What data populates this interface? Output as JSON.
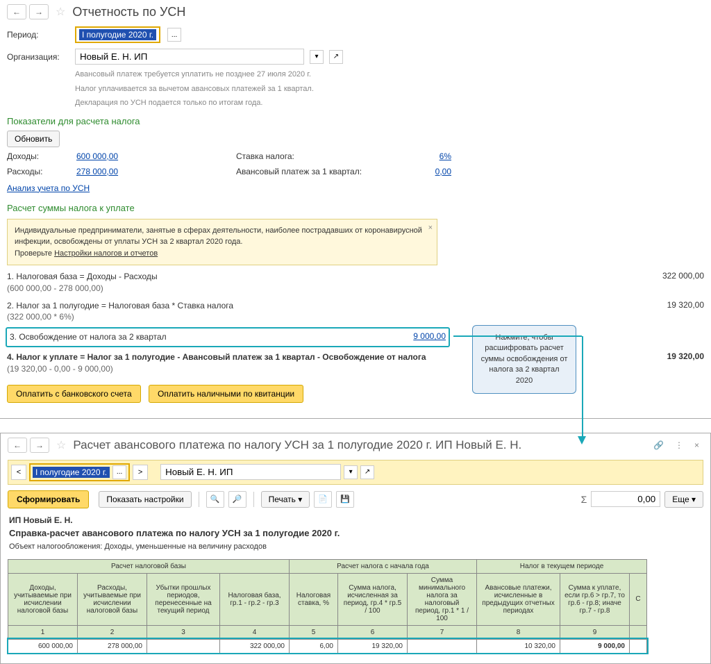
{
  "top": {
    "title": "Отчетность по УСН",
    "period_label": "Период:",
    "period_value": "I полугодие 2020 г.",
    "org_label": "Организация:",
    "org_value": "Новый Е. Н. ИП",
    "info1": "Авансовый платеж требуется уплатить не позднее 27 июля 2020 г.",
    "info2": "Налог уплачивается за вычетом авансовых платежей за 1 квартал.",
    "info3": "Декларация по УСН подается только по итогам года.",
    "section1": "Показатели для расчета налога",
    "refresh": "Обновить",
    "income_label": "Доходы:",
    "income_value": "600 000,00",
    "rate_label": "Ставка налога:",
    "rate_value": "6%",
    "expense_label": "Расходы:",
    "expense_value": "278 000,00",
    "advance_label": "Авансовый платеж за 1 квартал:",
    "advance_value": "0,00",
    "analysis_link": "Анализ учета по УСН",
    "section2": "Расчет суммы налога к уплате",
    "warning": "Индивидуальные предприниматели, занятые в сферах деятельности, наиболее пострадавших от коронавирусной инфекции, освобождены от уплаты УСН за 2 квартал 2020 года.\nПроверьте ",
    "warning_link": "Настройки налогов и отчетов",
    "calc1_text": "1. Налоговая база = Доходы - Расходы",
    "calc1_sub": "(600 000,00 - 278 000,00)",
    "calc1_val": "322 000,00",
    "calc2_text": "2. Налог за 1 полугодие = Налоговая база * Ставка налога",
    "calc2_sub": "(322 000,00 * 6%)",
    "calc2_val": "19 320,00",
    "calc3_text": "3. Освобождение от налога за 2 квартал",
    "calc3_val": "9 000,00",
    "calc4_text": "4. Налог к уплате = Налог за 1 полугодие - Авансовый платеж за 1 квартал - Освобождение от налога",
    "calc4_sub": "(19 320,00 - 0,00 - 9 000,00)",
    "calc4_val": "19 320,00",
    "pay_bank": "Оплатить с банковского счета",
    "pay_cash": "Оплатить наличными по квитанции",
    "callout": "Нажмите, чтобы расшифровать расчет суммы освобождения от налога за 2 квартал 2020"
  },
  "bottom": {
    "title": "Расчет авансового платежа по налогу УСН за 1 полугодие 2020 г. ИП Новый Е. Н.",
    "period_value": "I полугодие 2020 г.",
    "org_value": "Новый Е. Н. ИП",
    "form_btn": "Сформировать",
    "settings_btn": "Показать настройки",
    "print_btn": "Печать",
    "sum_value": "0,00",
    "more_btn": "Еще",
    "report_org": "ИП Новый Е. Н.",
    "report_title": "Справка-расчет авансового платежа по налогу УСН за 1 полугодие 2020 г.",
    "report_obj": "Объект налогообложения:     Доходы, уменьшенные на величину расходов",
    "group1": "Расчет налоговой базы",
    "group2": "Расчет налога с начала года",
    "group3": "Налог в текущем периоде",
    "h1": "Доходы, учитываемые при исчислении налоговой базы",
    "h2": "Расходы, учитываемые при исчислении налоговой базы",
    "h3": "Убытки прошлых периодов, перенесенные на текущий период",
    "h4": "Налоговая база, гр.1 - гр.2 - гр.3",
    "h5": "Налоговая ставка, %",
    "h6": "Сумма налога, исчисленная за период, гр.4 * гр.5 / 100",
    "h7": "Сумма минимального налога за налоговый период, гр.1 * 1 / 100",
    "h8": "Авансовые платежи, исчисленные в предыдущих отчетных периодах",
    "h9": "Сумма к уплате, если гр.6 > гр.7, то гр.6 - гр.8; иначе гр.7 - гр.8",
    "h10": "С",
    "n1": "1",
    "n2": "2",
    "n3": "3",
    "n4": "4",
    "n5": "5",
    "n6": "6",
    "n7": "7",
    "n8": "8",
    "n9": "9",
    "d1": "600 000,00",
    "d2": "278 000,00",
    "d3": "",
    "d4": "322 000,00",
    "d5": "6,00",
    "d6": "19 320,00",
    "d7": "",
    "d8": "10 320,00",
    "d9": "9 000,00"
  }
}
